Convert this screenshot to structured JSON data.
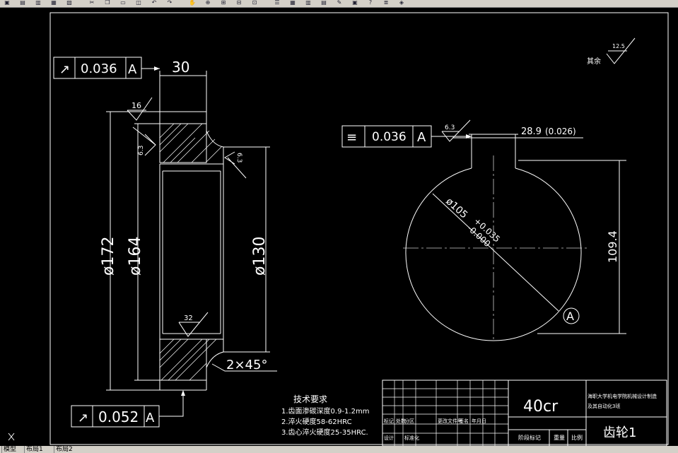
{
  "toolbar": {
    "icons": [
      "open-icon",
      "save-icon",
      "print-icon",
      "preview-icon",
      "plot-icon",
      "cut-icon",
      "copy-icon",
      "paste-icon",
      "match-icon",
      "undo-icon",
      "redo-icon",
      "pan-icon",
      "zoom-realtime-icon",
      "zoom-window-icon",
      "zoom-previous-icon",
      "zoom-extents-icon",
      "properties-icon",
      "design-center-icon",
      "tool-palette-icon",
      "sheet-set-icon",
      "markup-icon",
      "calculator-icon",
      "help-icon",
      "layer-icon",
      "layer-state-icon"
    ]
  },
  "tabs": [
    "模型",
    "布局1",
    "布局2"
  ],
  "drawing": {
    "roughness_other": "12.5",
    "roughness_other_label": "其余",
    "left_view": {
      "runout_top": {
        "symbol": "↗",
        "value": "0.036",
        "datum": "A"
      },
      "width_dim": "30",
      "roughness_top": "16",
      "roughness_side_left": "6.3",
      "roughness_side_right": "6.3",
      "roughness_bore": "32",
      "dia_outer": "ø172",
      "dia_pitch": "ø164",
      "dia_bore": "ø130",
      "chamfer": "2×45°",
      "runout_bottom": {
        "symbol": "↗",
        "value": "0.052",
        "datum": "A"
      }
    },
    "right_view": {
      "symmetry": {
        "symbol": "≡",
        "value": "0.036",
        "datum": "A"
      },
      "roughness_key": "6.3",
      "keyway_width": "28.9",
      "keyway_tol": "(0.026)",
      "keyway_depth": "109.4",
      "bore_dia": "ø105",
      "bore_tol_upper": "+0.035",
      "bore_tol_lower": "-0.000",
      "datum": "A"
    },
    "tech_requirements": {
      "title": "技术要求",
      "items": [
        "1.齿面渗碳深度0.9-1.2mm",
        "2.淬火硬度58-62HRC",
        "3.齿心淬火硬度25-35HRC."
      ]
    },
    "title_block": {
      "material": "40cr",
      "school": "海职大学机电学院机械设计制造及其自动化3班",
      "part_name": "齿轮1",
      "row_labels": [
        "标记",
        "处数",
        "分区",
        "更改文件号",
        "签名",
        "年月日"
      ],
      "row_labels2": [
        "设计",
        "标准化",
        "阶段标记",
        "重量",
        "比例"
      ]
    }
  }
}
